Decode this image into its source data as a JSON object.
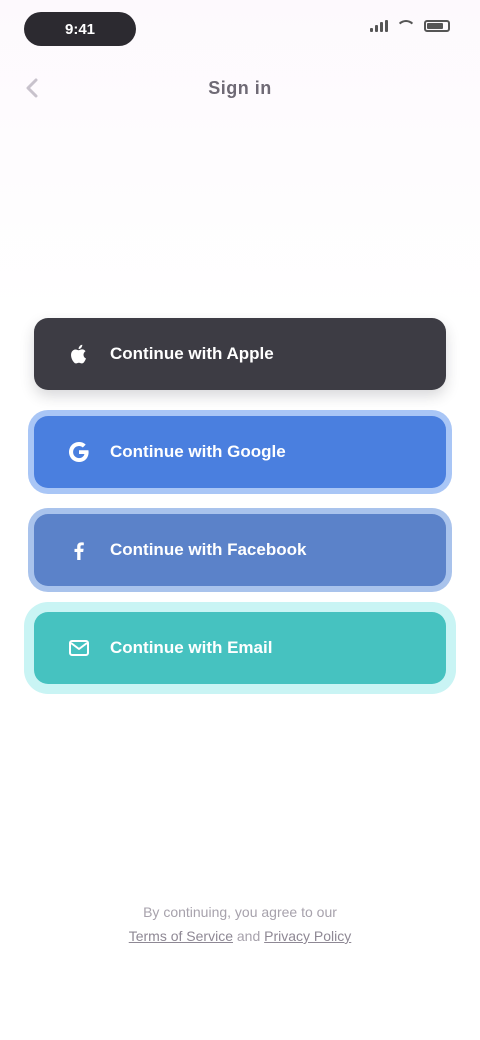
{
  "status_bar": {
    "time": "9:41",
    "icons": [
      "signal-icon",
      "wifi-icon",
      "battery-icon"
    ]
  },
  "header": {
    "back_icon": "chevron-left-icon",
    "title": "Sign in"
  },
  "sign_in_buttons": [
    {
      "id": "apple",
      "label": "Continue with Apple",
      "icon": "apple-icon",
      "color": "#3d3c44"
    },
    {
      "id": "google",
      "label": "Continue with Google",
      "icon": "google-icon",
      "color": "#4a7fdf"
    },
    {
      "id": "facebook",
      "label": "Continue with Facebook",
      "icon": "facebook-icon",
      "color": "#5b82c9"
    },
    {
      "id": "email",
      "label": "Continue with Email",
      "icon": "mail-icon",
      "color": "#46c2c0"
    }
  ],
  "footer": {
    "line1": "By continuing, you agree to our",
    "terms_link": "Terms of Service",
    "joiner": "and",
    "privacy_link": "Privacy Policy"
  }
}
